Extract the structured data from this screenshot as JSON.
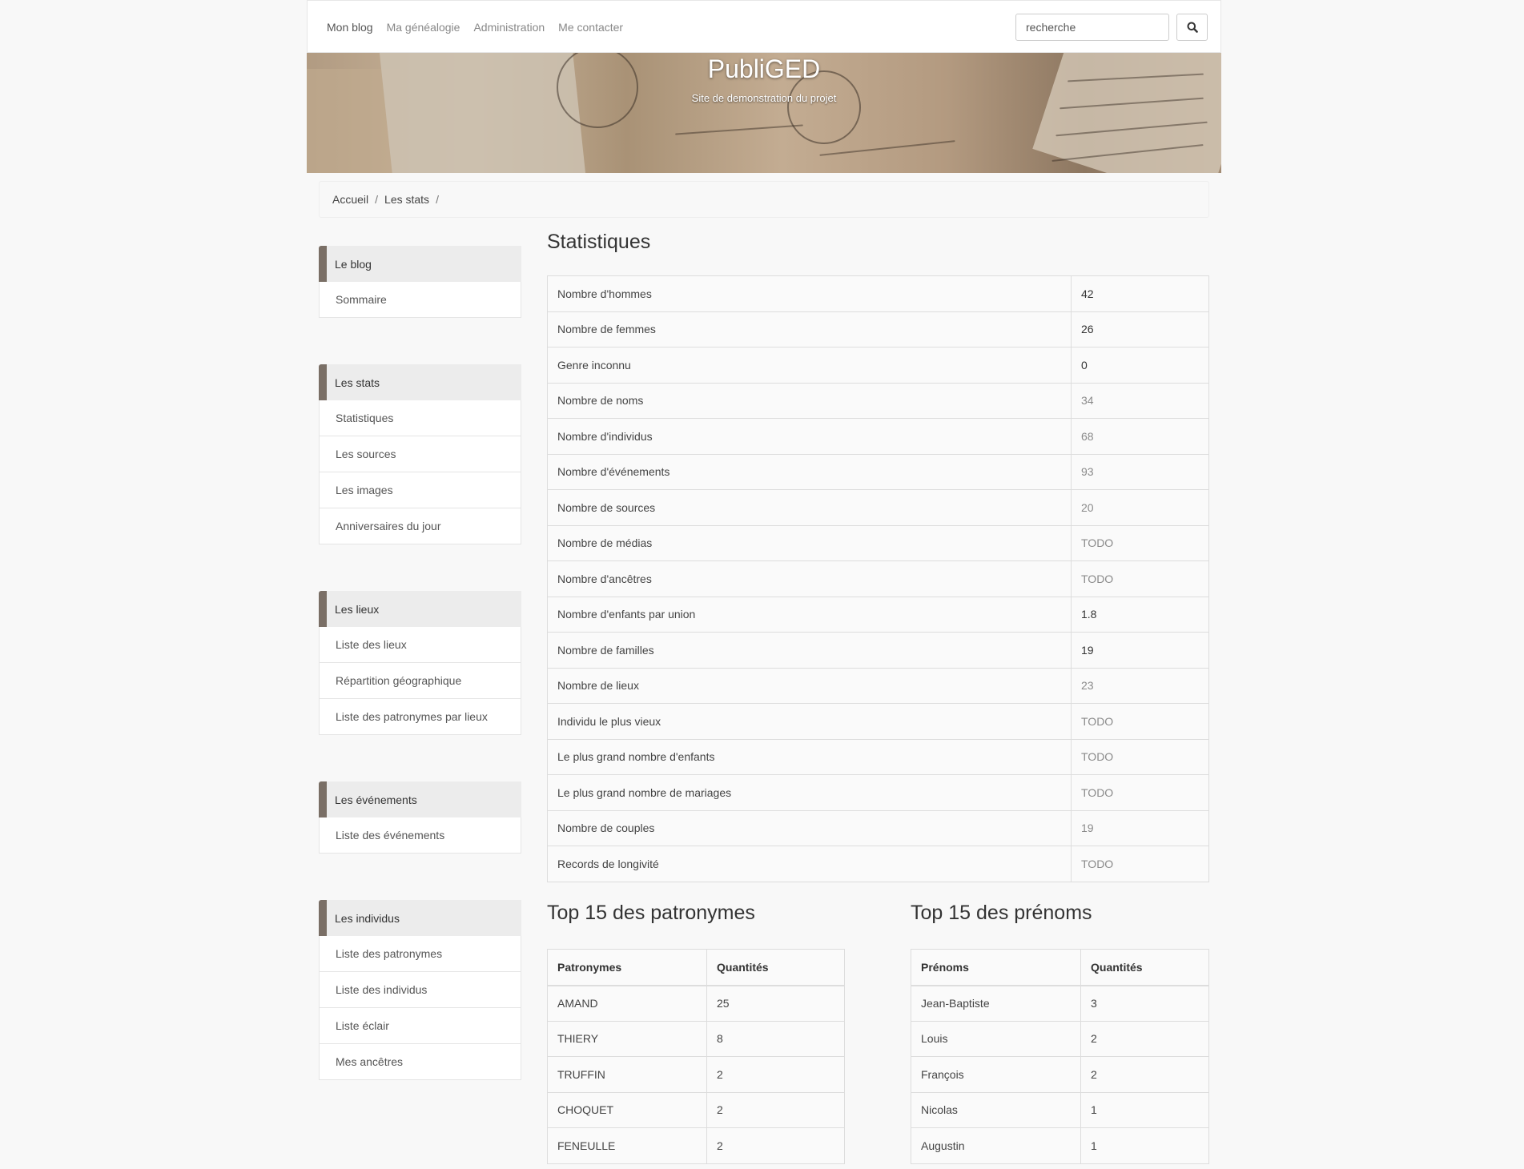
{
  "nav": {
    "links": [
      "Mon blog",
      "Ma généalogie",
      "Administration",
      "Me contacter"
    ],
    "search_placeholder": "recherche"
  },
  "banner": {
    "title": "PubliGED",
    "subtitle": "Site de demonstration du projet"
  },
  "breadcrumb": [
    "Accueil",
    "Les stats"
  ],
  "sidebar": [
    {
      "heading": "Le blog",
      "items": [
        "Sommaire"
      ]
    },
    {
      "heading": "Les stats",
      "items": [
        "Statistiques",
        "Les sources",
        "Les images",
        "Anniversaires du jour"
      ]
    },
    {
      "heading": "Les lieux",
      "items": [
        "Liste des lieux",
        "Répartition géographique",
        "Liste des patronymes par lieux"
      ]
    },
    {
      "heading": "Les événements",
      "items": [
        "Liste des événements"
      ]
    },
    {
      "heading": "Les individus",
      "items": [
        "Liste des patronymes",
        "Liste des individus",
        "Liste éclair",
        "Mes ancêtres"
      ]
    }
  ],
  "main": {
    "title": "Statistiques",
    "stats": [
      {
        "label": "Nombre d'hommes",
        "value": "42",
        "muted": false
      },
      {
        "label": "Nombre de femmes",
        "value": "26",
        "muted": false
      },
      {
        "label": "Genre inconnu",
        "value": "0",
        "muted": false
      },
      {
        "label": "Nombre de noms",
        "value": "34",
        "muted": true
      },
      {
        "label": "Nombre d'individus",
        "value": "68",
        "muted": true
      },
      {
        "label": "Nombre d'événements",
        "value": "93",
        "muted": true
      },
      {
        "label": "Nombre de sources",
        "value": "20",
        "muted": true
      },
      {
        "label": "Nombre de médias",
        "value": "TODO",
        "muted": true
      },
      {
        "label": "Nombre d'ancêtres",
        "value": "TODO",
        "muted": true
      },
      {
        "label": "Nombre d'enfants par union",
        "value": "1.8",
        "muted": false
      },
      {
        "label": "Nombre de familles",
        "value": "19",
        "muted": false
      },
      {
        "label": "Nombre de lieux",
        "value": "23",
        "muted": true
      },
      {
        "label": "Individu le plus vieux",
        "value": "TODO",
        "muted": true
      },
      {
        "label": "Le plus grand nombre d'enfants",
        "value": "TODO",
        "muted": true
      },
      {
        "label": "Le plus grand nombre de mariages",
        "value": "TODO",
        "muted": true
      },
      {
        "label": "Nombre de couples",
        "value": "19",
        "muted": true
      },
      {
        "label": "Records de longivité",
        "value": "TODO",
        "muted": true
      }
    ],
    "top_surnames": {
      "title": "Top 15 des patronymes",
      "headers": [
        "Patronymes",
        "Quantités"
      ],
      "rows": [
        [
          "AMAND",
          "25"
        ],
        [
          "THIERY",
          "8"
        ],
        [
          "TRUFFIN",
          "2"
        ],
        [
          "CHOQUET",
          "2"
        ],
        [
          "FENEULLE",
          "2"
        ]
      ]
    },
    "top_firstnames": {
      "title": "Top 15 des prénoms",
      "headers": [
        "Prénoms",
        "Quantités"
      ],
      "rows": [
        [
          "Jean-Baptiste",
          "3"
        ],
        [
          "Louis",
          "2"
        ],
        [
          "François",
          "2"
        ],
        [
          "Nicolas",
          "1"
        ],
        [
          "Augustin",
          "1"
        ]
      ]
    }
  },
  "colors": {
    "sidebar_accent": "#7a6f66",
    "background": "#f8f8f8"
  }
}
